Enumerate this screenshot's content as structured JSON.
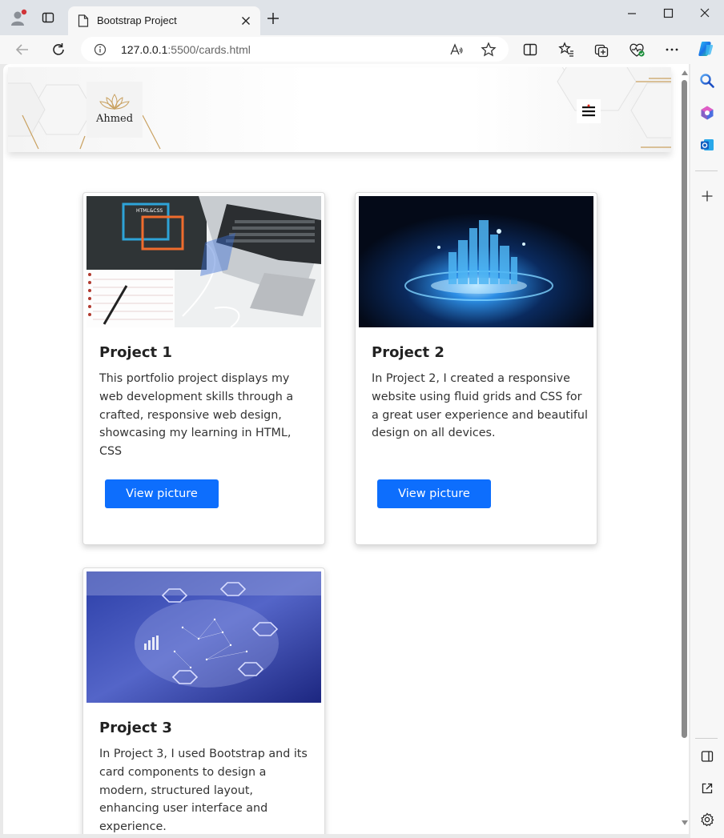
{
  "browser": {
    "tab_title": "Bootstrap Project",
    "url_host": "127.0.0.1",
    "url_rest": ":5500/cards.html",
    "icons": [
      "profile-icon",
      "tab-actions-icon",
      "page-icon",
      "close-tab-icon",
      "new-tab-icon",
      "minimize-icon",
      "maximize-icon",
      "close-window-icon",
      "back-icon",
      "refresh-icon",
      "info-icon",
      "read-aloud-icon",
      "favorite-star-icon",
      "split-screen-icon",
      "favorites-icon",
      "collections-icon",
      "browser-essentials-icon",
      "more-icon",
      "copilot-icon"
    ]
  },
  "sidebar": {
    "icons": [
      "search-icon",
      "office-icon",
      "outlook-icon",
      "add-icon",
      "sidebar-toggle-icon",
      "open-external-icon",
      "settings-icon"
    ]
  },
  "header": {
    "logo_text": "Ahmed"
  },
  "cards": [
    {
      "title": "Project 1",
      "text": "This portfolio project displays my web development skills through a crafted, responsive web design, showcasing my learning in HTML, CSS",
      "button": "View picture",
      "image_label": "HTML&CSS"
    },
    {
      "title": "Project 2",
      "text": "In Project 2, I created a responsive website using fluid grids and CSS for a great user experience and beautiful design on all devices.",
      "button": "View picture"
    },
    {
      "title": "Project 3",
      "text": "In Project 3, I used Bootstrap and its card components to design a modern, structured layout, enhancing user interface and experience."
    }
  ],
  "colors": {
    "primary_button": "#0d6efd",
    "titlebar": "#dfe3e8"
  }
}
